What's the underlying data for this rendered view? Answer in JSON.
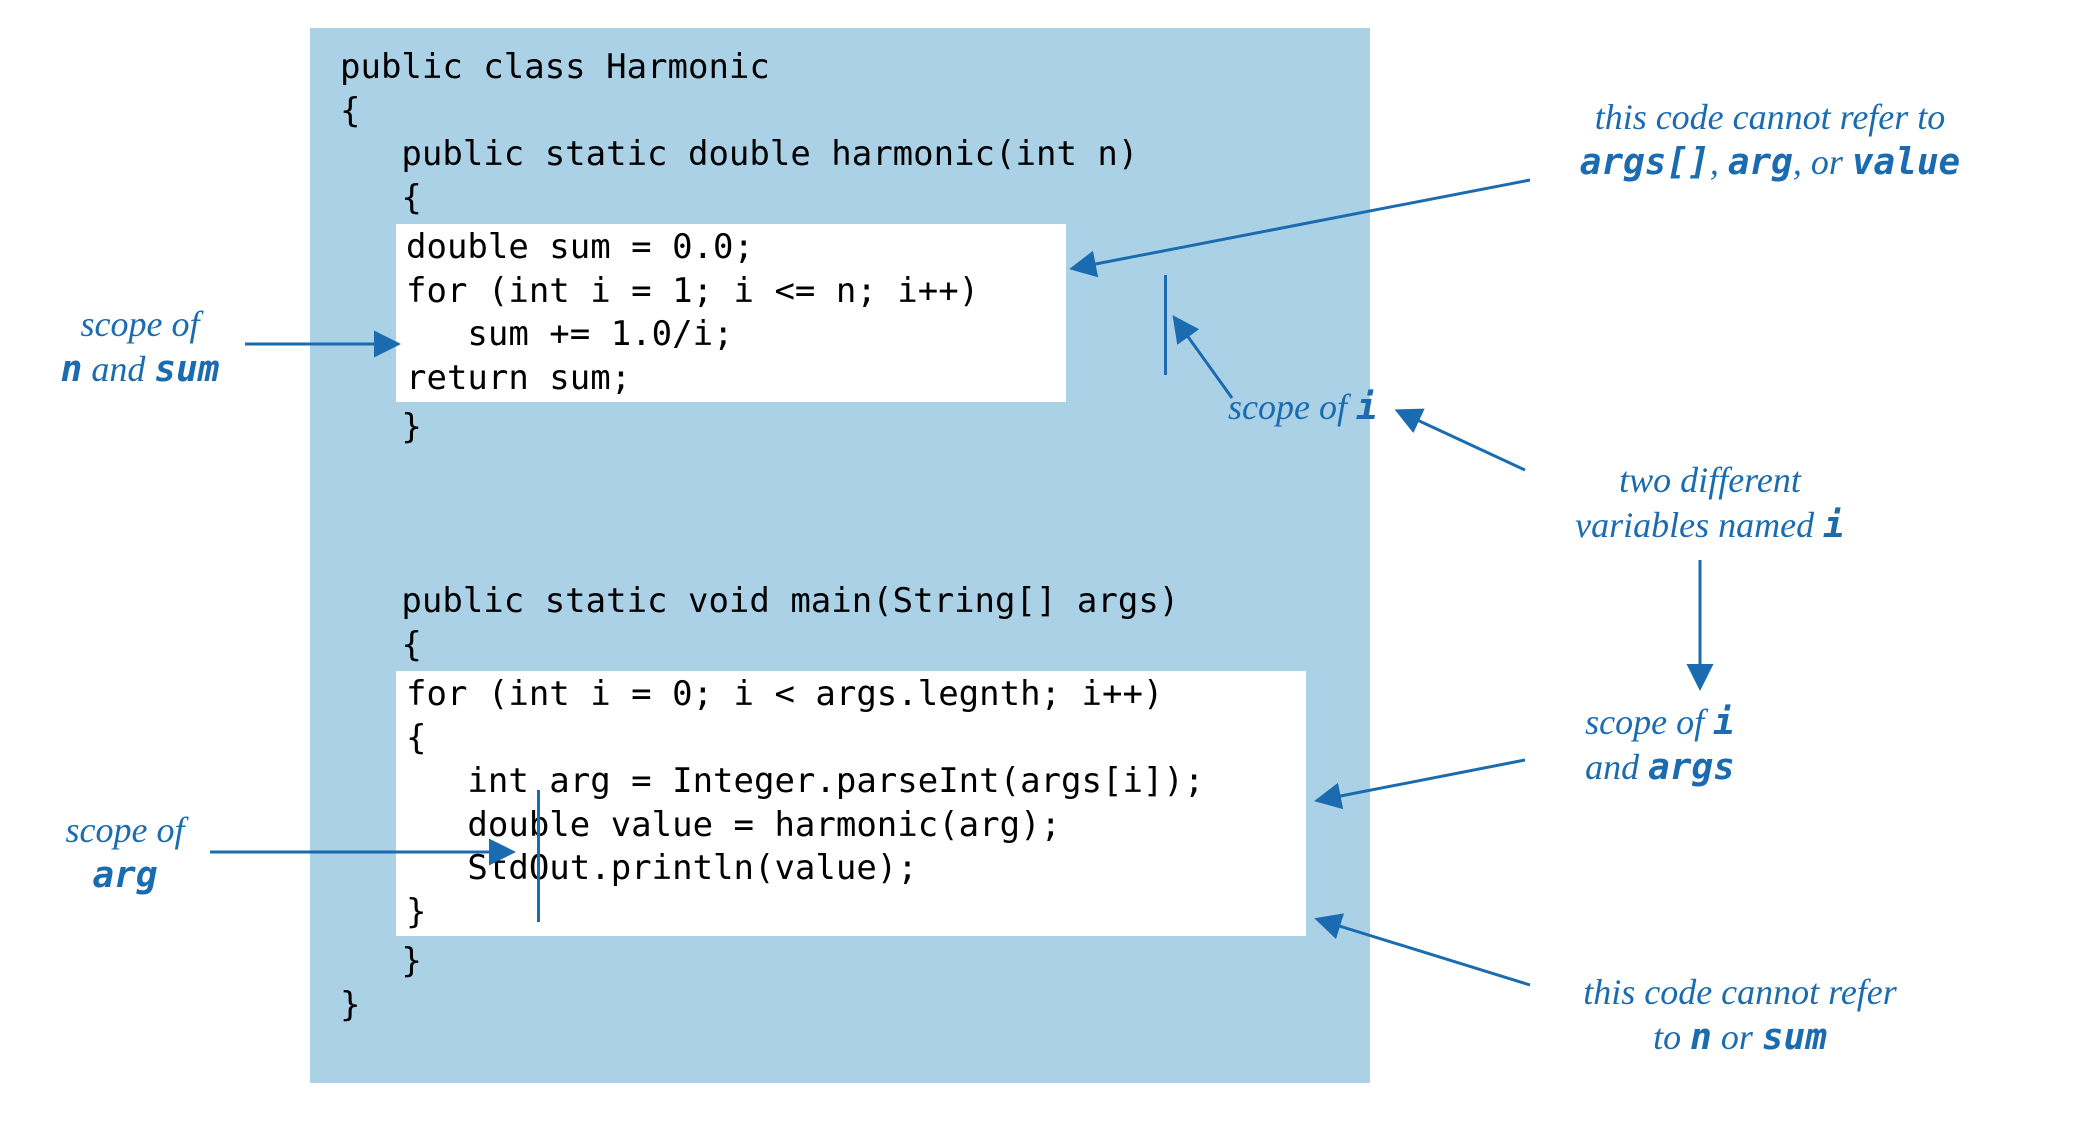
{
  "code": {
    "l1": "public class Harmonic",
    "l2": "{",
    "l3": "   public static double harmonic(int n)",
    "l4": "   {",
    "l5a": "double sum = 0.0;",
    "l5b": "for (int i = 1; i <= n; i++)",
    "l5c": "   sum += 1.0/i;",
    "l5d": "return sum;",
    "l6": "   }",
    "gap": "",
    "l7": "   public static void main(String[] args)",
    "l8": "   {",
    "l9a": "for (int i = 0; i < args.legnth; i++)",
    "l9b": "{",
    "l9c": "   int arg = Integer.parseInt(args[i]);",
    "l9d": "   double value = harmonic(arg);",
    "l9e": "   StdOut.println(value);",
    "l9f": "}",
    "l10": "   }",
    "l11": "}"
  },
  "ann": {
    "scope_n_sum_1": "scope of",
    "scope_n_sum_2a": "n",
    "scope_n_sum_2b": " and ",
    "scope_n_sum_2c": "sum",
    "scope_arg_1": "scope of",
    "scope_arg_2": "arg",
    "scope_i_top_1": "scope of ",
    "scope_i_top_1b": "i",
    "cannot_top_1": "this code cannot refer to",
    "cannot_top_2a": "args[]",
    "cannot_top_2b": ", ",
    "cannot_top_2c": "arg",
    "cannot_top_2d": ", or ",
    "cannot_top_2e": "value",
    "two_i_1": "two different",
    "two_i_2a": "variables named ",
    "two_i_2b": "i",
    "scope_i_args_1a": "scope of ",
    "scope_i_args_1b": "i",
    "scope_i_args_2a": "and ",
    "scope_i_args_2b": "args",
    "cannot_bot_1": "this code cannot refer",
    "cannot_bot_2a": "to ",
    "cannot_bot_2b": "n",
    "cannot_bot_2c": " or ",
    "cannot_bot_2d": "sum"
  }
}
